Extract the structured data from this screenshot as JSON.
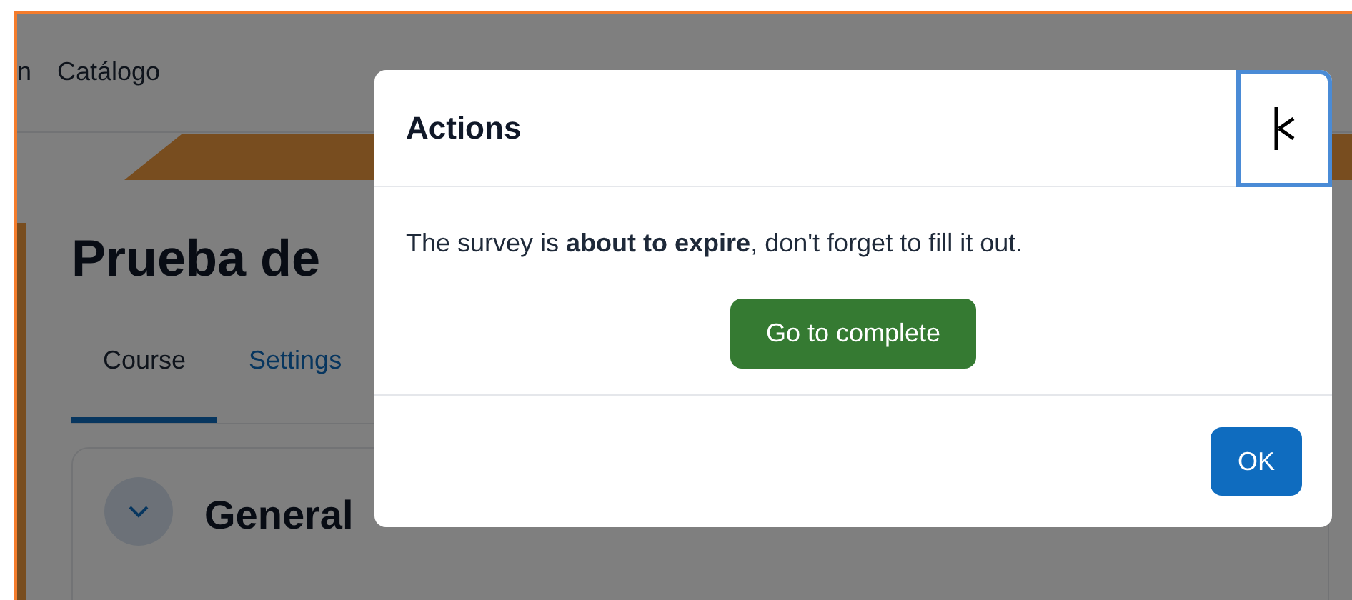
{
  "navbar": {
    "items": [
      {
        "label": "n"
      },
      {
        "label": "Catálogo"
      }
    ]
  },
  "course": {
    "title": "Prueba de",
    "tabs": [
      {
        "label": "Course",
        "selected": true
      },
      {
        "label": "Settings",
        "selected": false
      }
    ],
    "section": {
      "title": "General",
      "expanded": true
    }
  },
  "dialog": {
    "title": "Actions",
    "message": "The survey is **about to expire**, don't forget to fill it out.",
    "action_button": "Go to complete",
    "ok_button": "OK"
  }
}
